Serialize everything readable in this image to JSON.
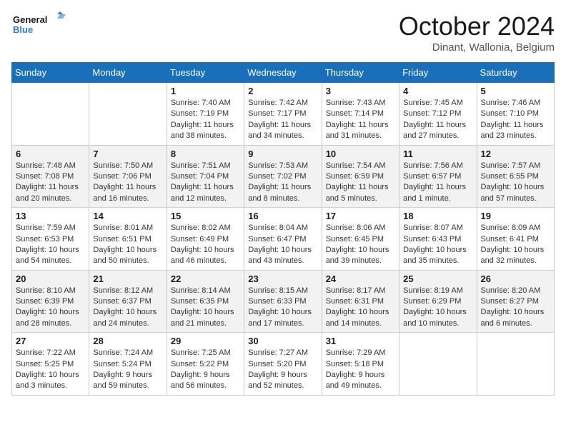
{
  "header": {
    "logo_line1": "General",
    "logo_line2": "Blue",
    "month_title": "October 2024",
    "location": "Dinant, Wallonia, Belgium"
  },
  "days_of_week": [
    "Sunday",
    "Monday",
    "Tuesday",
    "Wednesday",
    "Thursday",
    "Friday",
    "Saturday"
  ],
  "weeks": [
    [
      {
        "day": "",
        "sunrise": "",
        "sunset": "",
        "daylight": ""
      },
      {
        "day": "",
        "sunrise": "",
        "sunset": "",
        "daylight": ""
      },
      {
        "day": "1",
        "sunrise": "Sunrise: 7:40 AM",
        "sunset": "Sunset: 7:19 PM",
        "daylight": "Daylight: 11 hours and 38 minutes."
      },
      {
        "day": "2",
        "sunrise": "Sunrise: 7:42 AM",
        "sunset": "Sunset: 7:17 PM",
        "daylight": "Daylight: 11 hours and 34 minutes."
      },
      {
        "day": "3",
        "sunrise": "Sunrise: 7:43 AM",
        "sunset": "Sunset: 7:14 PM",
        "daylight": "Daylight: 11 hours and 31 minutes."
      },
      {
        "day": "4",
        "sunrise": "Sunrise: 7:45 AM",
        "sunset": "Sunset: 7:12 PM",
        "daylight": "Daylight: 11 hours and 27 minutes."
      },
      {
        "day": "5",
        "sunrise": "Sunrise: 7:46 AM",
        "sunset": "Sunset: 7:10 PM",
        "daylight": "Daylight: 11 hours and 23 minutes."
      }
    ],
    [
      {
        "day": "6",
        "sunrise": "Sunrise: 7:48 AM",
        "sunset": "Sunset: 7:08 PM",
        "daylight": "Daylight: 11 hours and 20 minutes."
      },
      {
        "day": "7",
        "sunrise": "Sunrise: 7:50 AM",
        "sunset": "Sunset: 7:06 PM",
        "daylight": "Daylight: 11 hours and 16 minutes."
      },
      {
        "day": "8",
        "sunrise": "Sunrise: 7:51 AM",
        "sunset": "Sunset: 7:04 PM",
        "daylight": "Daylight: 11 hours and 12 minutes."
      },
      {
        "day": "9",
        "sunrise": "Sunrise: 7:53 AM",
        "sunset": "Sunset: 7:02 PM",
        "daylight": "Daylight: 11 hours and 8 minutes."
      },
      {
        "day": "10",
        "sunrise": "Sunrise: 7:54 AM",
        "sunset": "Sunset: 6:59 PM",
        "daylight": "Daylight: 11 hours and 5 minutes."
      },
      {
        "day": "11",
        "sunrise": "Sunrise: 7:56 AM",
        "sunset": "Sunset: 6:57 PM",
        "daylight": "Daylight: 11 hours and 1 minute."
      },
      {
        "day": "12",
        "sunrise": "Sunrise: 7:57 AM",
        "sunset": "Sunset: 6:55 PM",
        "daylight": "Daylight: 10 hours and 57 minutes."
      }
    ],
    [
      {
        "day": "13",
        "sunrise": "Sunrise: 7:59 AM",
        "sunset": "Sunset: 6:53 PM",
        "daylight": "Daylight: 10 hours and 54 minutes."
      },
      {
        "day": "14",
        "sunrise": "Sunrise: 8:01 AM",
        "sunset": "Sunset: 6:51 PM",
        "daylight": "Daylight: 10 hours and 50 minutes."
      },
      {
        "day": "15",
        "sunrise": "Sunrise: 8:02 AM",
        "sunset": "Sunset: 6:49 PM",
        "daylight": "Daylight: 10 hours and 46 minutes."
      },
      {
        "day": "16",
        "sunrise": "Sunrise: 8:04 AM",
        "sunset": "Sunset: 6:47 PM",
        "daylight": "Daylight: 10 hours and 43 minutes."
      },
      {
        "day": "17",
        "sunrise": "Sunrise: 8:06 AM",
        "sunset": "Sunset: 6:45 PM",
        "daylight": "Daylight: 10 hours and 39 minutes."
      },
      {
        "day": "18",
        "sunrise": "Sunrise: 8:07 AM",
        "sunset": "Sunset: 6:43 PM",
        "daylight": "Daylight: 10 hours and 35 minutes."
      },
      {
        "day": "19",
        "sunrise": "Sunrise: 8:09 AM",
        "sunset": "Sunset: 6:41 PM",
        "daylight": "Daylight: 10 hours and 32 minutes."
      }
    ],
    [
      {
        "day": "20",
        "sunrise": "Sunrise: 8:10 AM",
        "sunset": "Sunset: 6:39 PM",
        "daylight": "Daylight: 10 hours and 28 minutes."
      },
      {
        "day": "21",
        "sunrise": "Sunrise: 8:12 AM",
        "sunset": "Sunset: 6:37 PM",
        "daylight": "Daylight: 10 hours and 24 minutes."
      },
      {
        "day": "22",
        "sunrise": "Sunrise: 8:14 AM",
        "sunset": "Sunset: 6:35 PM",
        "daylight": "Daylight: 10 hours and 21 minutes."
      },
      {
        "day": "23",
        "sunrise": "Sunrise: 8:15 AM",
        "sunset": "Sunset: 6:33 PM",
        "daylight": "Daylight: 10 hours and 17 minutes."
      },
      {
        "day": "24",
        "sunrise": "Sunrise: 8:17 AM",
        "sunset": "Sunset: 6:31 PM",
        "daylight": "Daylight: 10 hours and 14 minutes."
      },
      {
        "day": "25",
        "sunrise": "Sunrise: 8:19 AM",
        "sunset": "Sunset: 6:29 PM",
        "daylight": "Daylight: 10 hours and 10 minutes."
      },
      {
        "day": "26",
        "sunrise": "Sunrise: 8:20 AM",
        "sunset": "Sunset: 6:27 PM",
        "daylight": "Daylight: 10 hours and 6 minutes."
      }
    ],
    [
      {
        "day": "27",
        "sunrise": "Sunrise: 7:22 AM",
        "sunset": "Sunset: 5:25 PM",
        "daylight": "Daylight: 10 hours and 3 minutes."
      },
      {
        "day": "28",
        "sunrise": "Sunrise: 7:24 AM",
        "sunset": "Sunset: 5:24 PM",
        "daylight": "Daylight: 9 hours and 59 minutes."
      },
      {
        "day": "29",
        "sunrise": "Sunrise: 7:25 AM",
        "sunset": "Sunset: 5:22 PM",
        "daylight": "Daylight: 9 hours and 56 minutes."
      },
      {
        "day": "30",
        "sunrise": "Sunrise: 7:27 AM",
        "sunset": "Sunset: 5:20 PM",
        "daylight": "Daylight: 9 hours and 52 minutes."
      },
      {
        "day": "31",
        "sunrise": "Sunrise: 7:29 AM",
        "sunset": "Sunset: 5:18 PM",
        "daylight": "Daylight: 9 hours and 49 minutes."
      },
      {
        "day": "",
        "sunrise": "",
        "sunset": "",
        "daylight": ""
      },
      {
        "day": "",
        "sunrise": "",
        "sunset": "",
        "daylight": ""
      }
    ]
  ]
}
